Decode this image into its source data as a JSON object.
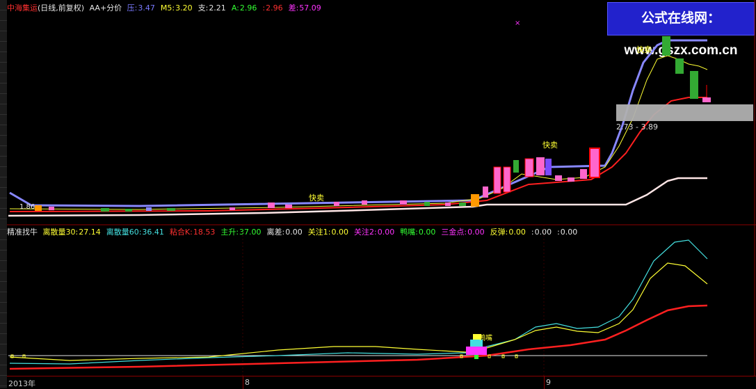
{
  "upper_header": {
    "stock_name": "中海集运",
    "period": "(日线,前复权)",
    "indicator": "AA+分价",
    "items": [
      {
        "label": "压:",
        "value": "3.47",
        "color": "#7a7aff"
      },
      {
        "label": "M5:",
        "value": "3.20",
        "color": "#ffff33"
      },
      {
        "label": "支:",
        "value": "2.21",
        "color": "#e6e6e6"
      },
      {
        "label": "A:",
        "value": "2.96",
        "color": "#33ff33"
      },
      {
        "label": ":",
        "value": "2.96",
        "color": "#ff3030"
      },
      {
        "label": "差:",
        "value": "57.09",
        "color": "#ff33ff"
      }
    ]
  },
  "watermark": "公式在线网：www.gszx.com.cn",
  "annotations": {
    "sell_label": "快卖",
    "left_price": "1.86",
    "range_label": "2.73 - 3.89",
    "duck_label": "鸭嘴"
  },
  "lower_header": {
    "title": "精准找牛",
    "items": [
      {
        "label": "离散量30:",
        "value": "27.14",
        "color": "#ffff33"
      },
      {
        "label": "离散量60:",
        "value": "36.41",
        "color": "#44e0e0"
      },
      {
        "label": "粘合K:",
        "value": "18.53",
        "color": "#ff3030"
      },
      {
        "label": "主升:",
        "value": "37.00",
        "color": "#33ff33"
      },
      {
        "label": "离差:",
        "value": "0.00",
        "color": "#e6e6e6"
      },
      {
        "label": "关注1:",
        "value": "0.00",
        "color": "#ffff33"
      },
      {
        "label": "关注2:",
        "value": "0.00",
        "color": "#ff33ff"
      },
      {
        "label": "鸭嘴:",
        "value": "0.00",
        "color": "#33ff33"
      },
      {
        "label": "三金点:",
        "value": "0.00",
        "color": "#ff33ff"
      },
      {
        "label": "反弹:",
        "value": "0.00",
        "color": "#ffff33"
      },
      {
        "label": ":",
        "value": "0.00",
        "color": "#e6e6e6"
      },
      {
        "label": ":",
        "value": "0.00",
        "color": "#e6e6e6"
      }
    ]
  },
  "x_axis": {
    "labels": [
      "2013年",
      "8",
      "9"
    ]
  },
  "colors": {
    "up": "#ff66cc",
    "down": "#33aa33",
    "resistance": "#8888ff",
    "support": "#ffe0e0",
    "ma_yellow": "#ffff33",
    "ma_red": "#ff2020"
  }
}
